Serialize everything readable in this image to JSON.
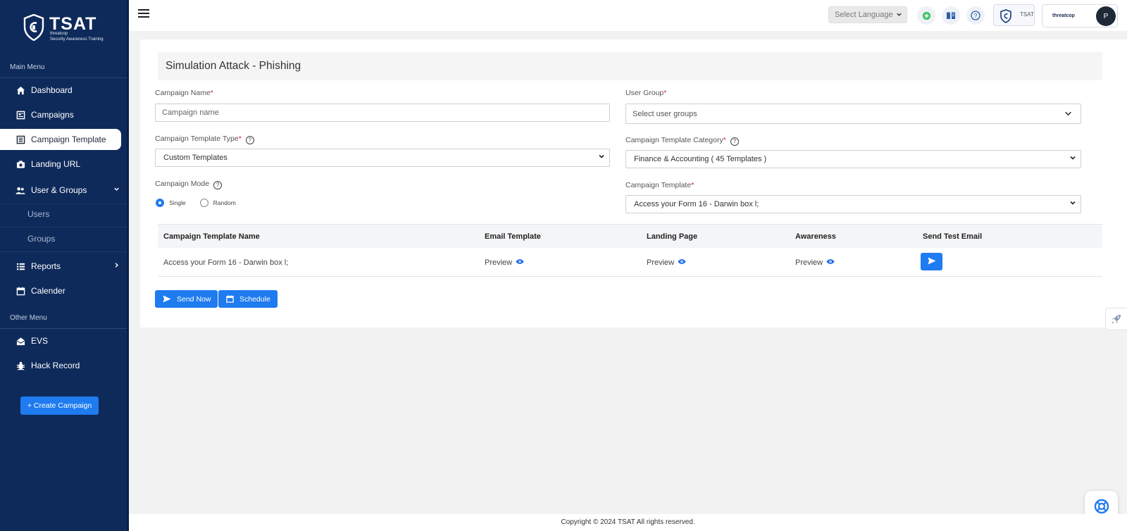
{
  "brand": {
    "name": "TSAT",
    "subtitle_line1": "threatcop",
    "subtitle_line2": "Security Awareness Training"
  },
  "sidebar": {
    "main_menu_heading": "Main Menu",
    "items": [
      {
        "label": "Dashboard",
        "icon": "home-icon"
      },
      {
        "label": "Campaigns",
        "icon": "campaigns-icon"
      },
      {
        "label": "Campaign Template",
        "icon": "template-icon",
        "active": true
      },
      {
        "label": "Landing URL",
        "icon": "camera-icon"
      },
      {
        "label": "User & Groups",
        "icon": "users-icon"
      },
      {
        "label": "Reports",
        "icon": "list-icon"
      },
      {
        "label": "Calender",
        "icon": "calendar-icon"
      }
    ],
    "sub_items": [
      "Users",
      "Groups"
    ],
    "other_menu_heading": "Other Menu",
    "other_items": [
      {
        "label": "EVS",
        "icon": "mail-open-icon"
      },
      {
        "label": "Hack Record",
        "icon": "bug-icon"
      }
    ],
    "create_button": "+ Create Campaign"
  },
  "topbar": {
    "language_placeholder": "Select Language",
    "brand_label": "TSAT",
    "company_logo_text": "threatcop",
    "avatar_initial": "P"
  },
  "page": {
    "title": "Simulation Attack - Phishing",
    "campaign_name_label": "Campaign Name",
    "campaign_name_placeholder": "Campaign name",
    "user_group_label": "User Group",
    "user_group_placeholder": "Select user groups",
    "template_type_label": "Campaign Template Type",
    "template_type_value": "Custom Templates",
    "template_category_label": "Campaign Template Category",
    "template_category_value": "Finance & Accounting ( 45 Templates )",
    "campaign_mode_label": "Campaign Mode",
    "mode_options": [
      "Single",
      "Random"
    ],
    "mode_selected": "Single",
    "campaign_template_label": "Campaign Template",
    "campaign_template_value": "Access your Form 16 - Darwin box l;"
  },
  "table": {
    "headers": [
      "Campaign Template Name",
      "Email Template",
      "Landing Page",
      "Awareness",
      "Send Test Email"
    ],
    "row": {
      "name": "Access your Form 16 - Darwin box l;",
      "email_preview": "Preview",
      "landing_preview": "Preview",
      "awareness_preview": "Preview"
    }
  },
  "actions": {
    "send_now": "Send Now",
    "schedule": "Schedule"
  },
  "footer": {
    "text": "Copyright © 2024 TSAT All rights reserved."
  },
  "colors": {
    "sidebar_bg": "#0e2a5a",
    "accent": "#1e7bf0",
    "required": "#dd2222"
  }
}
